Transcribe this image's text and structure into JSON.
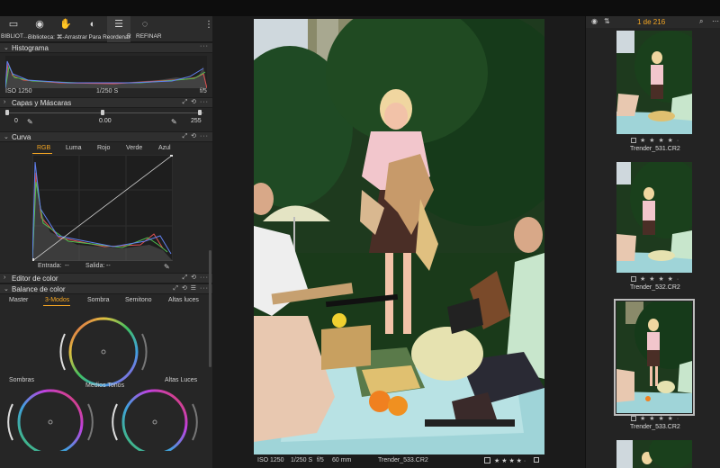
{
  "toolbar": {
    "tabs": [
      {
        "label": "BIBLIOT…",
        "icon": "folder-icon"
      },
      {
        "label": "Biblioteca: ⌘-Arrastrar Para Reordenar",
        "icon": "camera-icon"
      },
      {
        "label": "R",
        "icon": "hand-icon"
      },
      {
        "label": "REFINAR",
        "icon": "target-icon"
      }
    ]
  },
  "histogram": {
    "title": "Histograma",
    "iso": "ISO 1250",
    "shutter": "1/250 S",
    "aperture": "f/5"
  },
  "layers": {
    "title": "Capas y Máscaras",
    "v0": "0",
    "v1": "0.00",
    "v2": "255"
  },
  "curve": {
    "title": "Curva",
    "tabs": [
      "RGB",
      "Luma",
      "Rojo",
      "Verde",
      "Azul"
    ],
    "entrada_label": "Entrada:",
    "entrada_val": "--",
    "salida_label": "Salida:",
    "salida_val": "--"
  },
  "color_editor": {
    "title": "Editor de color"
  },
  "color_balance": {
    "title": "Balance de color",
    "tabs": [
      "Master",
      "3-Modos",
      "Sombra",
      "Semitono",
      "Altas luces"
    ],
    "sombras": "Sombras",
    "medios": "Medios Tonos",
    "altas": "Altas Luces"
  },
  "viewer": {
    "iso": "ISO 1250",
    "shutter": "1/250 S",
    "aperture": "f/5",
    "focal": "60 mm",
    "filename": "Trender_533.CR2",
    "stars": "★ ★ ★ ★ ·"
  },
  "browser": {
    "count": "1 de 216",
    "thumbs": [
      {
        "name": "Trender_531.CR2",
        "stars": "★ ★ ★ ★ ·"
      },
      {
        "name": "Trender_532.CR2",
        "stars": "★ ★ ★ ★ ·"
      },
      {
        "name": "Trender_533.CR2",
        "stars": "★ ★ ★ ★ ·"
      }
    ]
  },
  "colors": {
    "accent": "#f5a623",
    "panel": "#262626",
    "header": "#2f2f2f"
  }
}
